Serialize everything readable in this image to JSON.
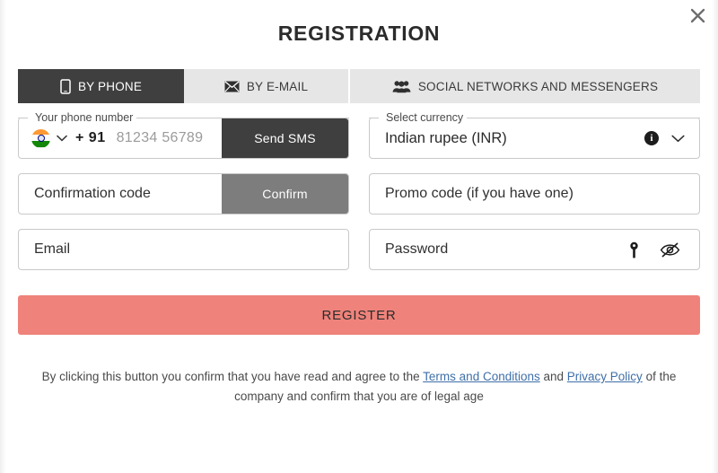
{
  "modal": {
    "title": "REGISTRATION",
    "close_icon": "close-icon"
  },
  "tabs": [
    {
      "label": "BY PHONE",
      "icon": "mobile-phone-icon",
      "active": true
    },
    {
      "label": "BY E-MAIL",
      "icon": "envelope-icon",
      "active": false
    },
    {
      "label": "SOCIAL NETWORKS AND MESSENGERS",
      "icon": "people-group-icon",
      "active": false
    }
  ],
  "form": {
    "phone": {
      "label": "Your phone number",
      "country_flag": "india-flag-icon",
      "country_code": "+ 91",
      "placeholder": "81234 56789",
      "value": "",
      "button_label": "Send SMS"
    },
    "currency": {
      "label": "Select currency",
      "value": "Indian rupee (INR)",
      "info_icon": "info-circle-icon",
      "chevron_icon": "chevron-down-icon"
    },
    "confirmation_code": {
      "placeholder": "Confirmation code",
      "value": "",
      "button_label": "Confirm"
    },
    "promo_code": {
      "placeholder": "Promo code (if you have one)",
      "value": ""
    },
    "email": {
      "placeholder": "Email",
      "value": ""
    },
    "password": {
      "placeholder": "Password",
      "value": "",
      "key_icon": "key-icon",
      "toggle_icon": "eye-slash-icon"
    },
    "submit_label": "REGISTER"
  },
  "footer": {
    "text_before": "By clicking this button you confirm that you have read and agree to the ",
    "terms_link": "Terms and Conditions",
    "text_between": " and ",
    "privacy_link": "Privacy Policy",
    "text_after": " of the company and confirm that you are of legal age"
  },
  "colors": {
    "accent": "#ef837b",
    "tab_active_bg": "#3f3f3f",
    "tab_bg": "#e6e6e6",
    "button_dark": "#3f3f3f",
    "button_mid": "#7d7d7d",
    "link": "#3f6fa8"
  }
}
